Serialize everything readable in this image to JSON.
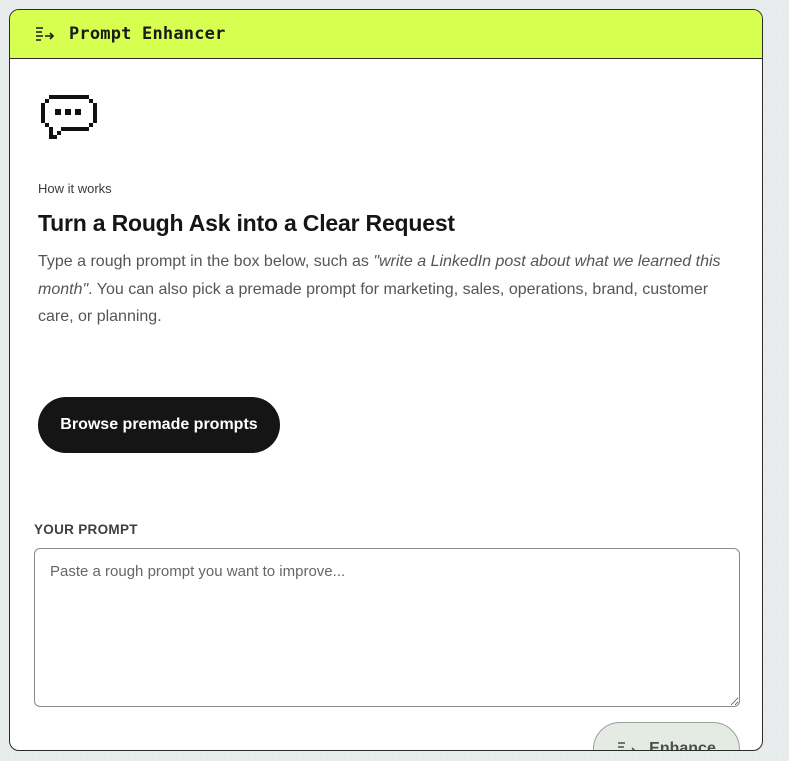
{
  "header": {
    "title": "Prompt Enhancer",
    "icon": "enhance-lines-arrow-icon"
  },
  "intro": {
    "icon": "chat-bubble-icon",
    "eyebrow": "How it works",
    "title": "Turn a Rough Ask into a Clear Request",
    "description_before": "Type a rough prompt in the box below, such as ",
    "description_example": "\"write a LinkedIn post about what we learned this month\"",
    "description_after": ". You can also pick a premade prompt for marketing, sales, operations, brand, customer care, or planning.",
    "browse_label": "Browse premade prompts"
  },
  "prompt": {
    "label": "YOUR PROMPT",
    "placeholder": "Paste a rough prompt you want to improve...",
    "value": ""
  },
  "actions": {
    "enhance_label": "Enhance",
    "enhance_icon": "enhance-lines-arrow-icon"
  },
  "colors": {
    "header_accent": "#d6ff4f",
    "primary_button": "#151515",
    "enhance_button": "#e4ebe3"
  }
}
